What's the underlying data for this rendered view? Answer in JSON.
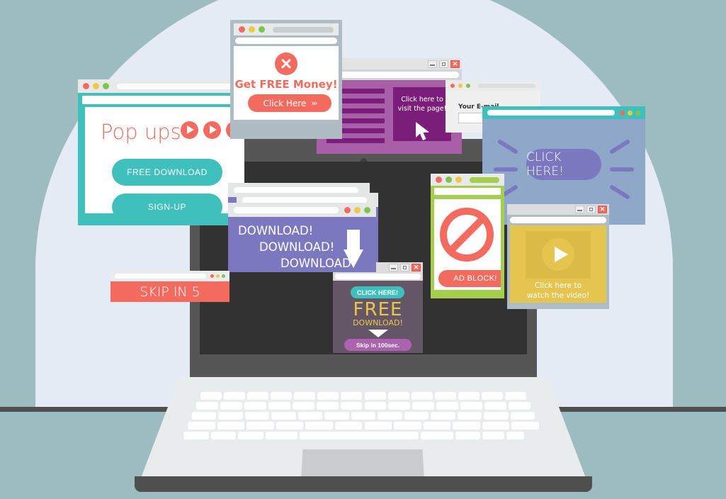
{
  "scene": {
    "title": "Pop-up ads flooding a laptop screen illustration",
    "background_color": "#9cbcc0",
    "arc_color": "#e4ebf5"
  },
  "laptop": {
    "name": "laptop",
    "screen_color": "#323232",
    "bezel_color": "#565656",
    "base_color": "#e9ecec"
  },
  "windows": {
    "popups": {
      "title_text": "Pop ups",
      "play_icons": 3,
      "buttons": [
        {
          "label": "FREE DOWNLOAD"
        },
        {
          "label": "SIGN-UP"
        }
      ],
      "accent": "#3fc0bd"
    },
    "money": {
      "heading": "Get FREE Money!",
      "button_label": "Click Here",
      "chevron": "»›",
      "accent": "#f26b5e"
    },
    "purple": {
      "box_text": "Click here to visit the page!",
      "body_color": "#a95fa8",
      "box_color": "#7a1e79",
      "text_lines": 6
    },
    "email": {
      "label": "Your E-mail",
      "input_value": "",
      "input_placeholder": ""
    },
    "blue": {
      "button_label": "CLICK HERE!",
      "body_color": "#8fa8ca",
      "button_color": "#7b78c0",
      "titlebar_color": "#3fc0bd"
    },
    "adblock": {
      "button_label": "AD BLOCK!",
      "frame_color": "#a5ce4e",
      "sign_color": "#f26b5e"
    },
    "download": {
      "lines": [
        "DOWNLOAD!",
        "DOWNLOAD!",
        "DOWNLOAD!"
      ],
      "body_color": "#7b78c0",
      "stack_count": 3
    },
    "free_download": {
      "pill_label": "CLICK HERE!",
      "big_text": "FREE",
      "sub_text": "DOWNLOAD!",
      "skip_label": "Skip in 100sec.",
      "body_color": "#645666",
      "accent": "#e8c84a"
    },
    "skip": {
      "label": "SKIP IN 5",
      "color": "#f26b5e"
    },
    "video": {
      "caption_line1": "Click here to",
      "caption_line2": "watch the video!",
      "body_color": "#e5c450"
    }
  },
  "window_controls": {
    "close": "✕",
    "minimize": "—",
    "maximize": "☐"
  }
}
